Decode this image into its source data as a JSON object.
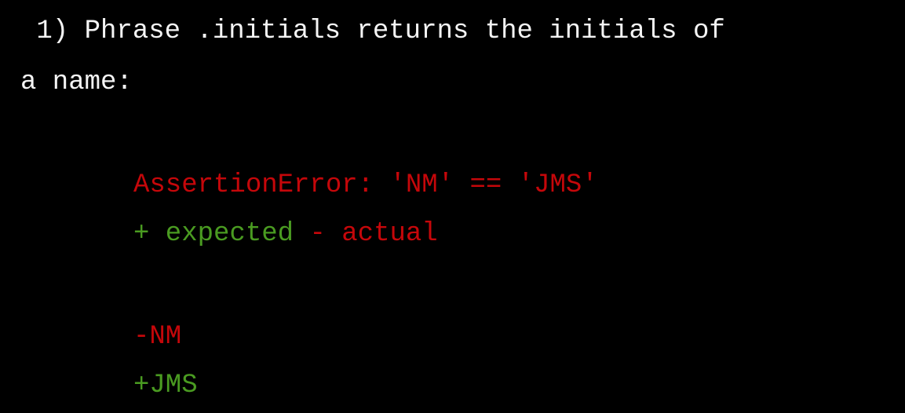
{
  "test": {
    "title_line_1": " 1) Phrase .initials returns the initials of",
    "title_line_2": "a name:"
  },
  "error": {
    "message": "AssertionError: 'NM' == 'JMS'"
  },
  "legend": {
    "expected": "+ expected",
    "separator": " ",
    "actual": "- actual"
  },
  "diff": {
    "removed": "-NM",
    "added": "+JMS"
  },
  "colors": {
    "background": "#000000",
    "text": "#f4f4f4",
    "error_red": "#c5070a",
    "expected_green": "#4a9b21"
  }
}
